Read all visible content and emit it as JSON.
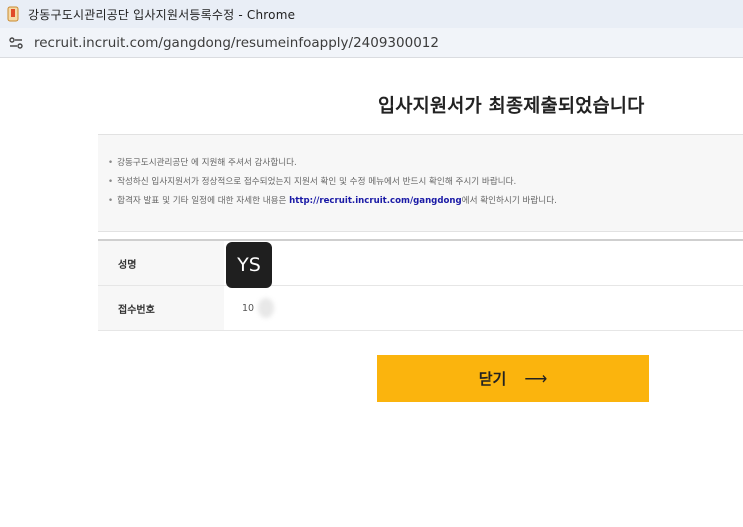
{
  "browser": {
    "window_title": "강동구도시관리공단 입사지원서등록수정 - Chrome",
    "url": "recruit.incruit.com/gangdong/resumeinfoapply/2409300012"
  },
  "page": {
    "heading": "입사지원서가 최종제출되었습니다",
    "notices": {
      "line1": "강동구도시관리공단 에 지원해 주셔서 감사합니다.",
      "line2": "작성하신 입사지원서가 정상적으로 접수되었는지 지원서 확인 및 수정 메뉴에서 반드시 확인해 주시기 바랍니다.",
      "line3_before": "합격자 발표 및 기타 일정에 대한 자세한 내용은 ",
      "line3_link": "http://recruit.incruit.com/gangdong",
      "line3_after": "에서 확인하시기 바랍니다."
    },
    "table": {
      "name_label": "성명",
      "name_value": "YS",
      "receipt_label": "접수번호",
      "receipt_value": "10"
    },
    "close_button": {
      "label": "닫기",
      "arrow": "⟶"
    }
  },
  "colors": {
    "accent": "#fbb40d",
    "link": "#1a1aa6"
  }
}
